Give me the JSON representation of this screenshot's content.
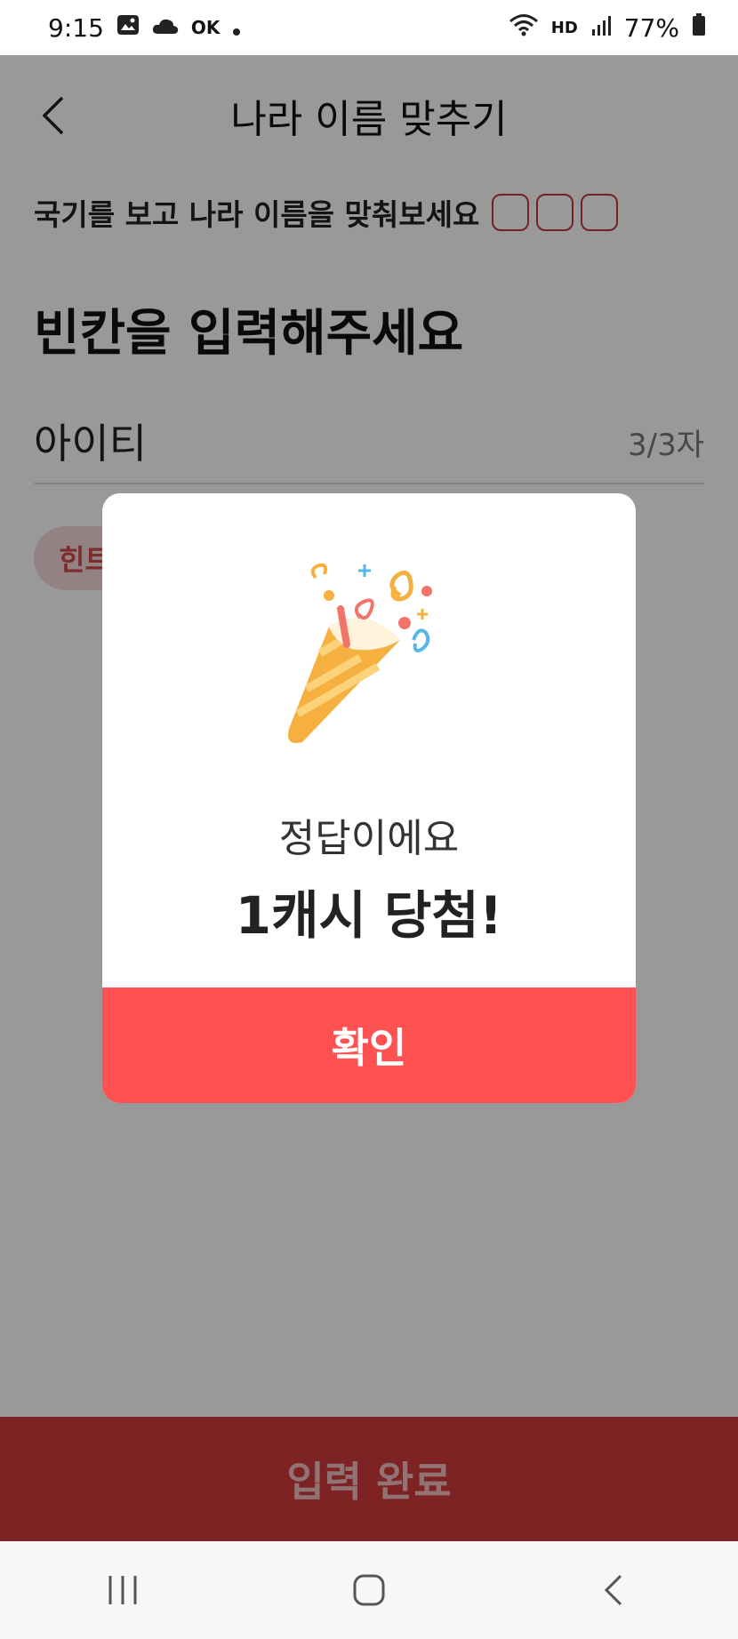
{
  "status_bar": {
    "time": "9:15",
    "left_icons": [
      "gallery-icon",
      "cloud-icon",
      "ok-icon",
      "dot-icon"
    ],
    "right_icons": [
      "wifi-icon",
      "hd-voice-icon",
      "signal-icon",
      "battery-icon"
    ],
    "network_label": "HD",
    "battery": "77%"
  },
  "header": {
    "title": "나라 이름 맞추기",
    "back_icon": "chevron-left-icon"
  },
  "quiz": {
    "instruction": "국기를 보고 나라 이름을 맞춰보세요",
    "answer_box_count": 3,
    "prompt": "빈칸을 입력해주세요",
    "input_value": "아이티",
    "char_count": "3/3자",
    "hint_label": "힌트"
  },
  "footer": {
    "submit_label": "입력 완료"
  },
  "modal": {
    "illustration": "party-popper-icon",
    "subtitle": "정답이에요",
    "title": "1캐시 당첨!",
    "confirm_label": "확인"
  },
  "nav_bar": {
    "icons": [
      "recent-apps-icon",
      "home-icon",
      "back-icon"
    ]
  },
  "colors": {
    "accent": "#fe5151",
    "answer_box_border": "#c0393b",
    "submit_bg": "#d33b3b"
  }
}
